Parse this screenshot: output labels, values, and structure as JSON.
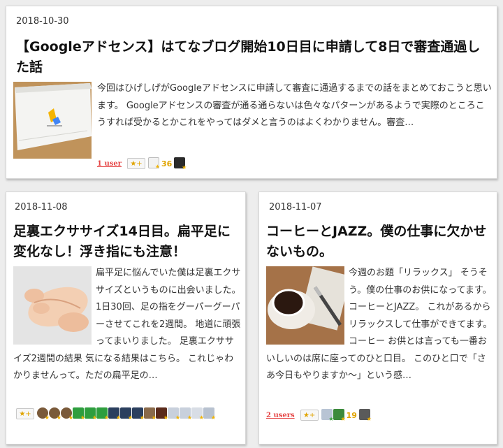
{
  "cards": [
    {
      "date": "2018-10-30",
      "title": "【Googleアドセンス】はてなブログ開始10日目に申請して8日で審査通過した話",
      "excerpt": "今回はひげしげがGoogleアドセンスに申請して審査に通過するまでの話をまとめておこうと思います。 Googleアドセンスの審査が通る通らないは色々なパターンがあるようで実際のところこうすれば受かるとかこれをやってはダメと言うのはよくわかりません。審査…",
      "users": "1 user",
      "star_button": "★+",
      "star_count": "36"
    },
    {
      "date": "2018-11-08",
      "title": "足裏エクササイズ14日目。扁平足に変化なし！浮き指にも注意！",
      "excerpt": "扁平足に悩んでいた僕は足裏エクササイズというものに出会いました。 1日30回、足の指をグーパーグーパーさせてこれを2週間。 地道に頑張ってまいりました。 足裏エクササイズ2週間の結果 気になる結果はこちら。 これじゃわかりませんって。ただの扁平足の…",
      "star_button": "★+"
    },
    {
      "date": "2018-11-07",
      "title": "コーヒーとJAZZ。僕の仕事に欠かせないもの。",
      "excerpt": "今週のお題「リラックス」 そうそう。僕の仕事のお供になってます。 コーヒーとJAZZ。 これがあるからリラックスして仕事ができてます。 コーヒー お供とは言っても一番おいしいのは席に座ってのひと口目。 このひと口で「さあ今日もやりますか～」という感…",
      "users": "2 users",
      "star_button": "★+",
      "star_count": "19"
    }
  ],
  "colors": {
    "users": "#e54545",
    "star": "#e0a400",
    "background": "#ededed"
  }
}
